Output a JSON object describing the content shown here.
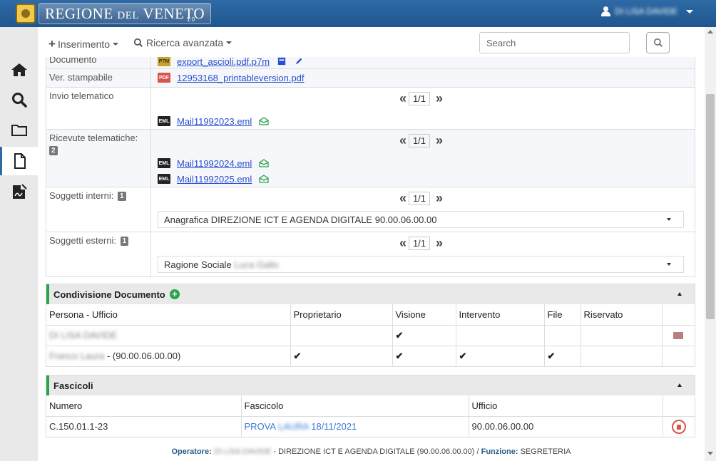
{
  "header": {
    "logo_main": "REGIONE",
    "logo_small": "DEL",
    "logo_end": "VENETO",
    "version": "1.0",
    "user_name": "DI LISA DAVIDE"
  },
  "sidebar": {
    "items": [
      {
        "name": "home-icon",
        "active": false
      },
      {
        "name": "search-icon",
        "active": false
      },
      {
        "name": "folder-icon",
        "active": false
      },
      {
        "name": "document-icon",
        "active": true
      },
      {
        "name": "signature-icon",
        "active": false
      }
    ]
  },
  "toolbar": {
    "insert_label": "Inserimento",
    "advanced_search_label": "Ricerca avanzata",
    "search_placeholder": "Search"
  },
  "detail": {
    "documento_label": "Documento",
    "documento_file": "export_ascioli.pdf.p7m",
    "documento_icon": "P7M",
    "stampabile_label": "Ver. stampabile",
    "stampabile_file": "12953168_printableversion.pdf",
    "stampabile_icon": "PDF",
    "invio_label": "Invio telematico",
    "invio_pager": "1/1",
    "invio_file": "Mail11992023.eml",
    "eml_icon": "EML",
    "ricevute_label": "Ricevute telematiche:",
    "ricevute_count": "2",
    "ricevute_pager": "1/1",
    "ricevute_files": [
      "Mail11992024.eml",
      "Mail11992025.eml"
    ],
    "interni_label": "Soggetti interni:",
    "interni_count": "1",
    "interni_pager": "1/1",
    "interni_value": "Anagrafica DIREZIONE ICT E AGENDA DIGITALE 90.00.06.00.00",
    "esterni_label": "Soggetti esterni:",
    "esterni_count": "1",
    "esterni_pager": "1/1",
    "esterni_prefix": "Ragione Sociale",
    "esterni_blur": "Luca Gallo"
  },
  "condivisione": {
    "title": "Condivisione Documento",
    "headers": [
      "Persona - Ufficio",
      "Proprietario",
      "Visione",
      "Intervento",
      "File",
      "Riservato"
    ],
    "rows": [
      {
        "persona": "DI LISA DAVIDE",
        "suffix": "",
        "checks": [
          false,
          true,
          false,
          false,
          false
        ]
      },
      {
        "persona": "Franco Laura",
        "suffix": "-  (90.00.06.00.00)",
        "checks": [
          true,
          true,
          true,
          true,
          false
        ]
      }
    ]
  },
  "fascicoli": {
    "title": "Fascicoli",
    "headers": [
      "Numero",
      "Fascicolo",
      "Ufficio"
    ],
    "row": {
      "numero": "C.150.01.1-23",
      "fascicolo_prefix": "PROVA",
      "fascicolo_blur": "LAURA",
      "fascicolo_date": "18/11/2021",
      "ufficio": "90.00.06.00.00"
    }
  },
  "footer": {
    "operatore_label": "Operatore:",
    "operatore_name": "DI LISA DAVIDE",
    "operatore_office": "- DIREZIONE ICT E AGENDA DIGITALE (90.00.06.00.00)",
    "sep": "/",
    "funzione_label": "Funzione:",
    "funzione_value": "SEGRETERIA"
  },
  "colors": {
    "header": "#1f568e",
    "accent_green": "#2aa34a",
    "link": "#2a4fd0",
    "danger": "#d9534f"
  }
}
